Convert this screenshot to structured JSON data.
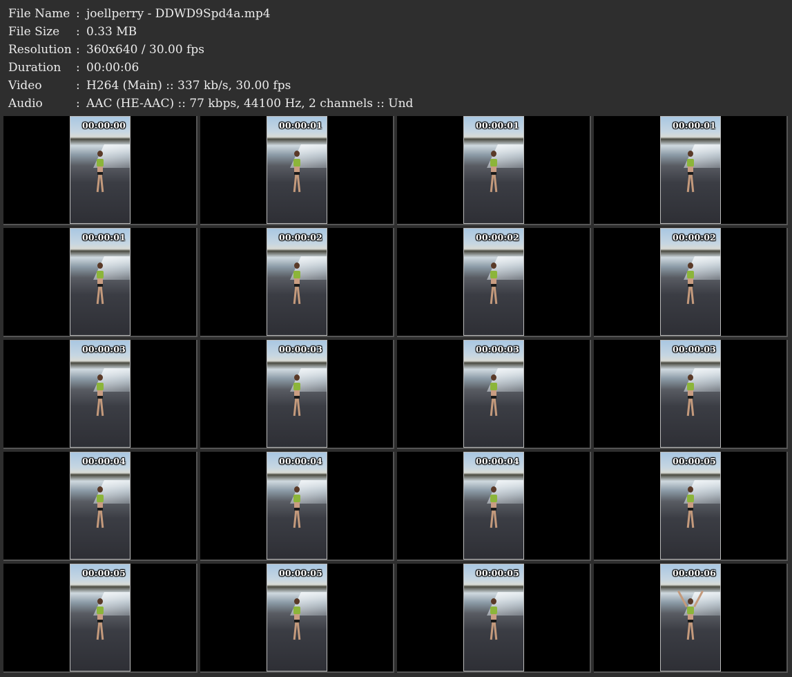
{
  "info": [
    {
      "label": "File Name",
      "sep": ":",
      "value": "joellperry - DDWD9Spd4a.mp4"
    },
    {
      "label": "File Size",
      "sep": ":",
      "value": "0.33 MB"
    },
    {
      "label": "Resolution",
      "sep": ":",
      "value": "360x640 / 30.00 fps"
    },
    {
      "label": "Duration",
      "sep": ":",
      "value": "00:00:06"
    },
    {
      "label": "Video",
      "sep": ":",
      "value": "H264 (Main) :: 337 kb/s, 30.00 fps"
    },
    {
      "label": "Audio",
      "sep": ":",
      "value": "AAC (HE-AAC) :: 77 kbps, 44100 Hz, 2 channels :: Und"
    }
  ],
  "thumbnails": [
    {
      "timestamp": "00:00:00"
    },
    {
      "timestamp": "00:00:01"
    },
    {
      "timestamp": "00:00:01"
    },
    {
      "timestamp": "00:00:01"
    },
    {
      "timestamp": "00:00:01"
    },
    {
      "timestamp": "00:00:02"
    },
    {
      "timestamp": "00:00:02"
    },
    {
      "timestamp": "00:00:02"
    },
    {
      "timestamp": "00:00:03"
    },
    {
      "timestamp": "00:00:03"
    },
    {
      "timestamp": "00:00:03"
    },
    {
      "timestamp": "00:00:03"
    },
    {
      "timestamp": "00:00:04"
    },
    {
      "timestamp": "00:00:04"
    },
    {
      "timestamp": "00:00:04"
    },
    {
      "timestamp": "00:00:05"
    },
    {
      "timestamp": "00:00:05"
    },
    {
      "timestamp": "00:00:05"
    },
    {
      "timestamp": "00:00:05"
    },
    {
      "timestamp": "00:00:06"
    }
  ],
  "colors": {
    "background": "#2e2e2e",
    "text": "#ececec",
    "cell_background": "#000000",
    "timestamp_text": "#ffffff"
  }
}
